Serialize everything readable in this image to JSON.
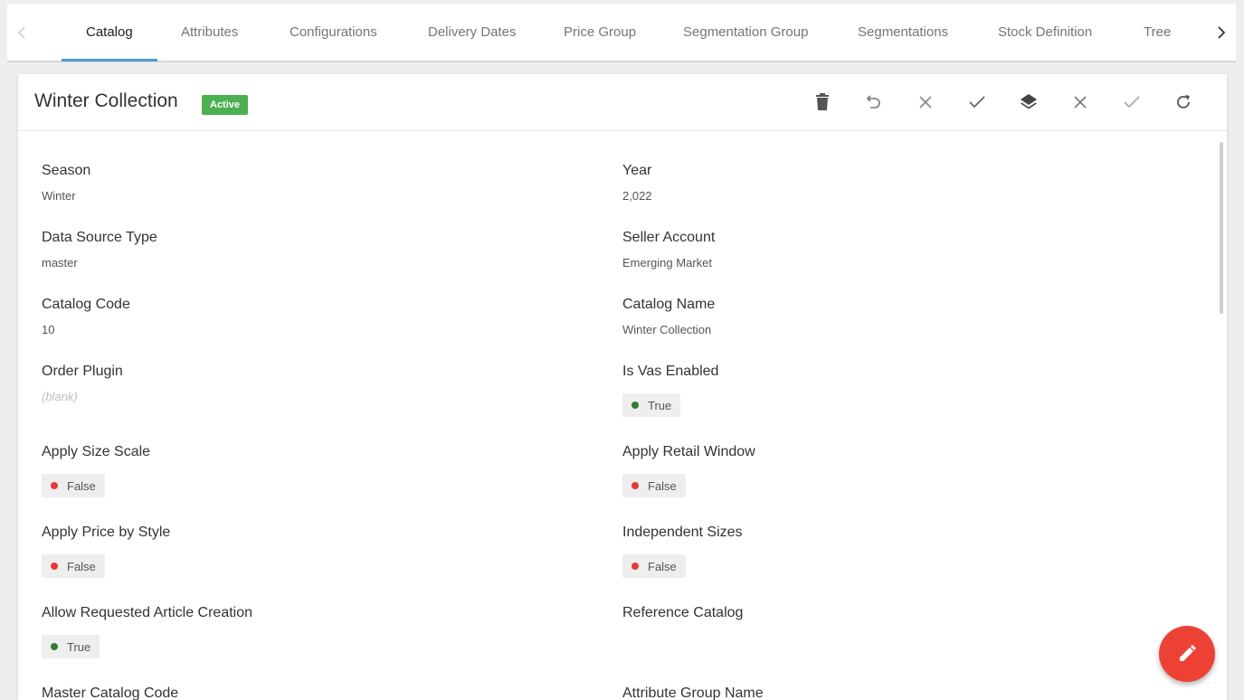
{
  "tabs": [
    {
      "label": "Catalog"
    },
    {
      "label": "Attributes"
    },
    {
      "label": "Configurations"
    },
    {
      "label": "Delivery Dates"
    },
    {
      "label": "Price Group"
    },
    {
      "label": "Segmentation Group"
    },
    {
      "label": "Segmentations"
    },
    {
      "label": "Stock Definition"
    },
    {
      "label": "Tree"
    }
  ],
  "active_tab": "Catalog",
  "header": {
    "title": "Winter Collection",
    "status": "Active",
    "toolbar_icons": [
      "delete-icon",
      "undo-icon",
      "close-icon",
      "check-icon",
      "layers-icon",
      "close-icon",
      "check-icon",
      "refresh-icon"
    ]
  },
  "fields": [
    {
      "label": "Season",
      "value": "Winter"
    },
    {
      "label": "Year",
      "value": "2,022"
    },
    {
      "label": "Data Source Type",
      "value": "master"
    },
    {
      "label": "Seller Account",
      "value": "Emerging Market"
    },
    {
      "label": "Catalog Code",
      "value": "10"
    },
    {
      "label": "Catalog Name",
      "value": "Winter Collection"
    },
    {
      "label": "Order Plugin",
      "value": "(blank)"
    },
    {
      "label": "Is Vas Enabled",
      "value": "True"
    },
    {
      "label": "Apply Size Scale",
      "value": "False"
    },
    {
      "label": "Apply Retail Window",
      "value": "False"
    },
    {
      "label": "Apply Price by Style",
      "value": "False"
    },
    {
      "label": "Independent Sizes",
      "value": "False"
    },
    {
      "label": "Allow Requested Article Creation",
      "value": "True"
    },
    {
      "label": "Reference Catalog",
      "value": ""
    },
    {
      "label": "Master Catalog Code",
      "value": ""
    },
    {
      "label": "Attribute Group Name",
      "value": ""
    }
  ],
  "colors": {
    "accent": "#4a9fd3",
    "active_badge": "#4caf50",
    "true_dot": "#2e7d32",
    "false_dot": "#e53935",
    "fab": "#ee4136"
  }
}
